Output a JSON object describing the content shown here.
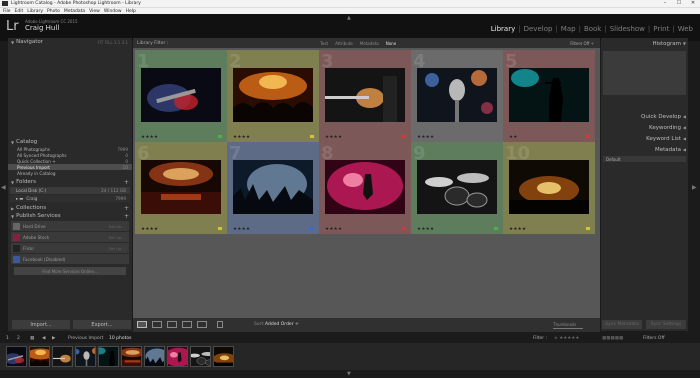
{
  "window": {
    "title": "Lightroom Catalog - Adobe Photoshop Lightroom - Library",
    "controls": [
      "–",
      "☐",
      "✕"
    ]
  },
  "menu": [
    "File",
    "Edit",
    "Library",
    "Photo",
    "Metadata",
    "View",
    "Window",
    "Help"
  ],
  "identity": {
    "logo": "Lr",
    "product": "Adobe Lightroom CC 2015",
    "user": "Craig Hull"
  },
  "modules": [
    {
      "label": "Library",
      "active": true
    },
    {
      "label": "Develop",
      "active": false
    },
    {
      "label": "Map",
      "active": false
    },
    {
      "label": "Book",
      "active": false
    },
    {
      "label": "Slideshow",
      "active": false
    },
    {
      "label": "Print",
      "active": false
    },
    {
      "label": "Web",
      "active": false
    }
  ],
  "left_panel": {
    "navigator": {
      "title": "Navigator",
      "tabs": "FIT  FILL  1:1  3:1"
    },
    "catalog": {
      "title": "Catalog",
      "items": [
        {
          "label": "All Photographs",
          "count": "7999"
        },
        {
          "label": "All Synced Photographs",
          "count": "0"
        },
        {
          "label": "Quick Collection +",
          "count": "0"
        },
        {
          "label": "Previous Import",
          "count": "10"
        },
        {
          "label": "Already in Catalog",
          "count": ""
        }
      ]
    },
    "folders": {
      "title": "Folders",
      "items": [
        {
          "label": "Local Disk (C:)",
          "count": "24 / 112 GB"
        },
        {
          "label": "Craig",
          "count": "7999"
        }
      ]
    },
    "collections": {
      "title": "Collections"
    },
    "publish": {
      "title": "Publish Services",
      "items": [
        {
          "label": "Hard Drive",
          "action": "Set Up..."
        },
        {
          "label": "Adobe Stock",
          "action": "Set Up..."
        },
        {
          "label": "Flickr",
          "action": "Set Up..."
        },
        {
          "label": "Facebook (Disabled)",
          "action": ""
        }
      ],
      "find_more": "Find More Services Online..."
    },
    "import_label": "Import...",
    "export_label": "Export..."
  },
  "center": {
    "filter_label": "Library Filter :",
    "filter_tabs": [
      {
        "label": "Text",
        "active": false
      },
      {
        "label": "Attribute",
        "active": false
      },
      {
        "label": "Metadata",
        "active": false
      },
      {
        "label": "None",
        "active": true
      }
    ],
    "filter_state": "Filters Off ÷",
    "photos": [
      {
        "num": "1",
        "bg": "#5d7d5d",
        "stars": "★★★★",
        "flag": "#4caf50",
        "scene": "guitar"
      },
      {
        "num": "2",
        "bg": "#7f7f4f",
        "stars": "★★★★",
        "flag": "#d4c33a",
        "scene": "crowd"
      },
      {
        "num": "3",
        "bg": "#7d5858",
        "stars": "★★★★",
        "flag": "#d03a3a",
        "scene": "guitar2"
      },
      {
        "num": "4",
        "bg": "#666666",
        "stars": "★★★★",
        "flag": "",
        "scene": "mic"
      },
      {
        "num": "5",
        "bg": "#7d5858",
        "stars": "★★",
        "flag": "#d03a3a",
        "scene": "singer"
      },
      {
        "num": "6",
        "bg": "#7f7f4f",
        "stars": "★★★★",
        "flag": "#d4c33a",
        "scene": "hall"
      },
      {
        "num": "7",
        "bg": "#5d6b86",
        "stars": "★★★★",
        "flag": "#3a6ad0",
        "scene": "hands"
      },
      {
        "num": "8",
        "bg": "#7d5858",
        "stars": "★★★★",
        "flag": "#d03a3a",
        "scene": "redstage"
      },
      {
        "num": "9",
        "bg": "#5d7d5d",
        "stars": "★★★★",
        "flag": "#4caf50",
        "scene": "drums"
      },
      {
        "num": "10",
        "bg": "#7f7f4f",
        "stars": "★★★★",
        "flag": "#d4c33a",
        "scene": "club"
      }
    ],
    "sort_label": "Sort:",
    "sort_value": "Added Order ÷",
    "thumbnails_label": "Thumbnails"
  },
  "right_panel": {
    "histogram": "Histogram",
    "quick_develop": "Quick Develop",
    "keywording": "Keywording",
    "keyword_list": "Keyword List",
    "metadata": "Metadata",
    "metadata_preset": "Default",
    "sync_metadata": "Sync Metadata",
    "sync_settings": "Sync Settings"
  },
  "filmstrip": {
    "source": "Previous Import",
    "count": "10 photos",
    "filter_label": "Filter :",
    "filter_state": "Filters Off",
    "pages": [
      "1",
      "2"
    ]
  },
  "colors": {
    "accent": "#e8e8e8",
    "red_label": "#d03a3a",
    "yellow_label": "#d4c33a",
    "green_label": "#4caf50",
    "blue_label": "#3a6ad0"
  }
}
